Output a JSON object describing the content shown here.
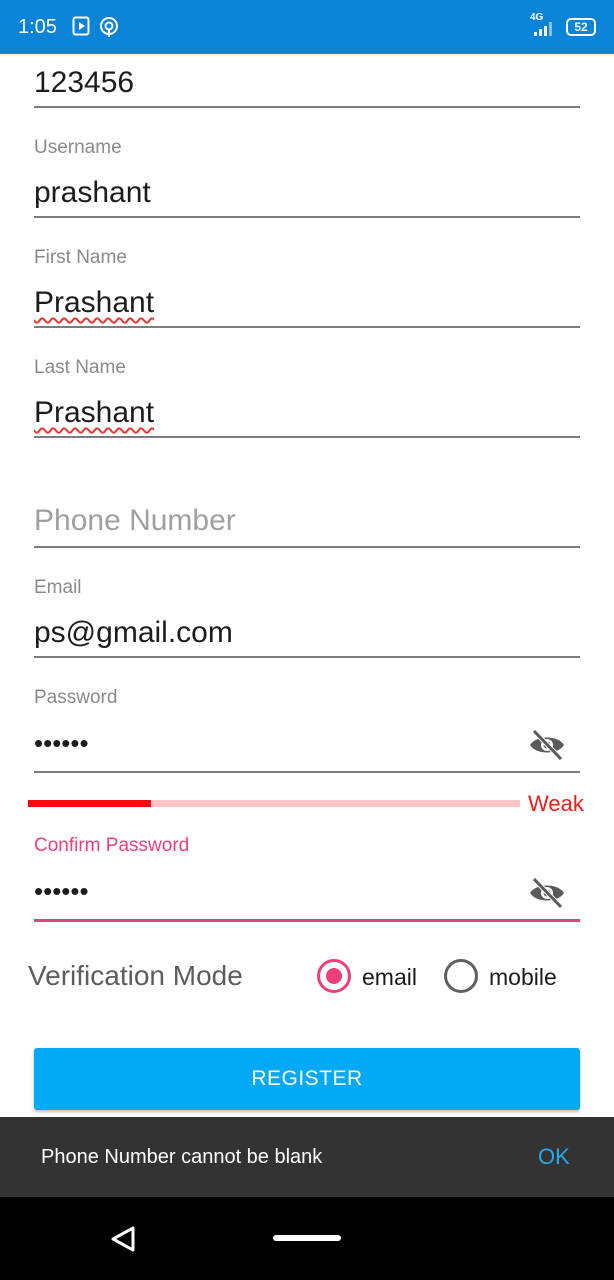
{
  "status_bar": {
    "time": "1:05",
    "network": "4G",
    "battery": "52",
    "icons": [
      "media-player-icon",
      "hotspot-icon",
      "signal-icon",
      "battery-icon"
    ]
  },
  "form": {
    "previous_field_value": "123456",
    "username": {
      "label": "Username",
      "value": "prashant"
    },
    "first_name": {
      "label": "First Name",
      "value": "Prashant"
    },
    "last_name": {
      "label": "Last Name",
      "value": "Prashant"
    },
    "phone": {
      "placeholder": "Phone Number",
      "value": ""
    },
    "email": {
      "label": "Email",
      "value": "ps@gmail.com"
    },
    "password": {
      "label": "Password",
      "value": "••••••",
      "strength_label": "Weak",
      "strength_fraction": 0.25
    },
    "confirm_password": {
      "label": "Confirm Password",
      "value": "••••••"
    }
  },
  "verification": {
    "label": "Verification Mode",
    "options": [
      {
        "label": "email",
        "selected": true
      },
      {
        "label": "mobile",
        "selected": false
      }
    ]
  },
  "register_button": "REGISTER",
  "snackbar": {
    "message": "Phone Number cannot be blank",
    "action": "OK"
  },
  "colors": {
    "status_bar": "#0a84d6",
    "accent": "#ec407a",
    "button": "#03a9f4",
    "strength_weak": "#f20c0c",
    "snackbar": "#333333",
    "snackbar_action": "#29a8e8"
  }
}
